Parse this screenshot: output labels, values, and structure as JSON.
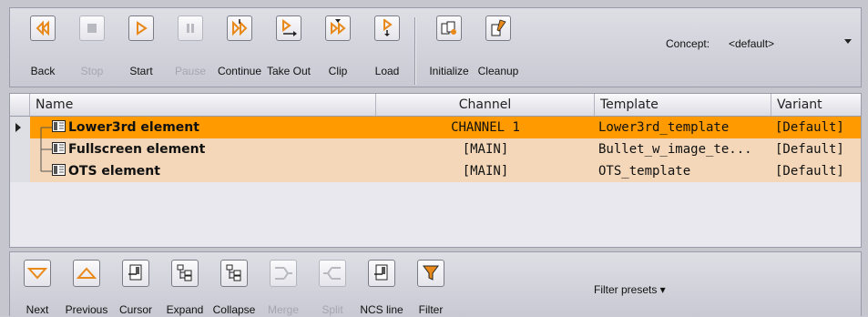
{
  "toolbar": {
    "buttons": [
      {
        "label": "Back",
        "icon": "rewind-icon",
        "enabled": true
      },
      {
        "label": "Stop",
        "icon": "stop-icon",
        "enabled": false
      },
      {
        "label": "Start",
        "icon": "play-icon",
        "enabled": true
      },
      {
        "label": "Pause",
        "icon": "pause-icon",
        "enabled": false
      },
      {
        "label": "Continue",
        "icon": "continue-icon",
        "enabled": true
      },
      {
        "label": "Take Out",
        "icon": "take-out-icon",
        "enabled": true
      },
      {
        "label": "Clip",
        "icon": "clip-icon",
        "enabled": true
      },
      {
        "label": "Load",
        "icon": "load-icon",
        "enabled": true
      },
      {
        "label": "Initialize",
        "icon": "initialize-icon",
        "enabled": true
      },
      {
        "label": "Cleanup",
        "icon": "cleanup-icon",
        "enabled": true
      }
    ],
    "concept_label": "Concept:",
    "concept_value": "<default>"
  },
  "grid": {
    "columns": [
      "Name",
      "Channel",
      "Template",
      "Variant"
    ],
    "rows": [
      {
        "name": "Lower3rd element",
        "channel": "CHANNEL 1",
        "template": "Lower3rd_template",
        "variant": "[Default]",
        "selected": true
      },
      {
        "name": "Fullscreen element",
        "channel": "[MAIN]",
        "template": "Bullet_w_image_te...",
        "variant": "[Default]",
        "selected": false
      },
      {
        "name": "OTS element",
        "channel": "[MAIN]",
        "template": "OTS_template",
        "variant": "[Default]",
        "selected": false
      }
    ]
  },
  "bottom_toolbar": {
    "buttons": [
      {
        "label": "Next",
        "icon": "next-icon",
        "enabled": true
      },
      {
        "label": "Previous",
        "icon": "previous-icon",
        "enabled": true
      },
      {
        "label": "Cursor",
        "icon": "cursor-icon",
        "enabled": true
      },
      {
        "label": "Expand",
        "icon": "expand-icon",
        "enabled": true
      },
      {
        "label": "Collapse",
        "icon": "collapse-icon",
        "enabled": true
      },
      {
        "label": "Merge",
        "icon": "merge-icon",
        "enabled": false
      },
      {
        "label": "Split",
        "icon": "split-icon",
        "enabled": false
      },
      {
        "label": "NCS line",
        "icon": "ncs-line-icon",
        "enabled": true
      },
      {
        "label": "Filter",
        "icon": "filter-icon",
        "enabled": true
      }
    ],
    "filter_presets_label": "Filter presets ▾"
  },
  "colors": {
    "accent_orange": "#f39a1e",
    "selected_row": "#ff9a00",
    "row_bg": "#f3d7b8"
  }
}
